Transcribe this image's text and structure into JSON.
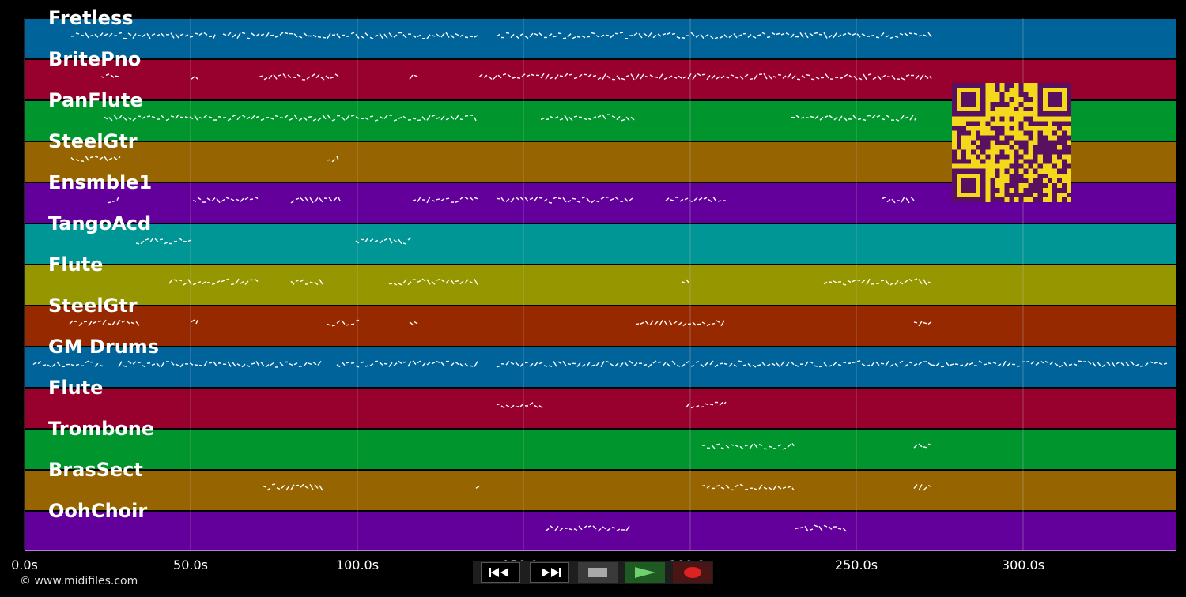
{
  "tracks": [
    {
      "name": "Fretless",
      "color": "#00649b"
    },
    {
      "name": "BritePno",
      "color": "#98002e"
    },
    {
      "name": "PanFlute",
      "color": "#00962d"
    },
    {
      "name": "SteelGtr",
      "color": "#966400"
    },
    {
      "name": "Ensmble1",
      "color": "#63009b"
    },
    {
      "name": "TangoAcd",
      "color": "#009696"
    },
    {
      "name": "Flute",
      "color": "#969600"
    },
    {
      "name": "SteelGtr",
      "color": "#962900"
    },
    {
      "name": "GM Drums",
      "color": "#00649b"
    },
    {
      "name": "Flute",
      "color": "#98002e"
    },
    {
      "name": "Trombone",
      "color": "#00962d"
    },
    {
      "name": "BrasSect",
      "color": "#966400"
    },
    {
      "name": "OohChoir",
      "color": "#63009b"
    }
  ],
  "timeline": {
    "ticks": [
      "0.0s",
      "50.0s",
      "100.0s",
      "150.0s",
      "200.0s",
      "250.0s",
      "300.0s"
    ]
  },
  "credit": "© www.midifiles.com",
  "transport": {
    "rewind_icon": "rewind-icon",
    "forward_icon": "fast-forward-icon",
    "stop_icon": "stop-icon",
    "play_icon": "play-icon",
    "record_icon": "record-icon"
  },
  "qr_code": {
    "icon": "qr-code-icon",
    "fg": "#5a1060",
    "bg": "#f3d81c"
  },
  "colors": {
    "background": "#000000",
    "note": "#ffffff",
    "grid": "#c8c8c8"
  }
}
